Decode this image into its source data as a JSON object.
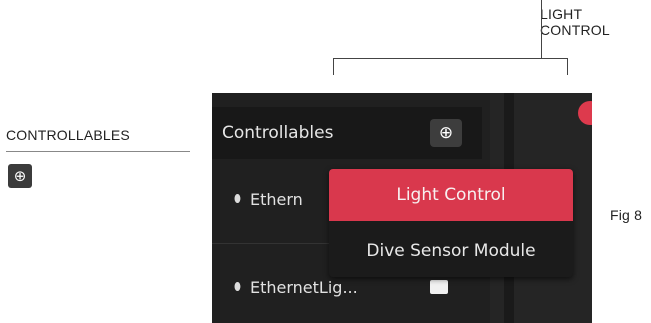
{
  "annotations": {
    "callout_line1": "LIGHT",
    "callout_line2": "CONTROL",
    "side_heading": "CONTROLLABLES",
    "side_plus_icon": "⊕",
    "figure_label": "Fig 8"
  },
  "panel": {
    "title": "Controllables",
    "add_icon": "⊕",
    "rows": [
      {
        "label": "Ethern"
      },
      {
        "label": "EthernetLig..."
      }
    ]
  },
  "menu": {
    "items": [
      {
        "label": "Light Control"
      },
      {
        "label": "Dive Sensor Module"
      }
    ]
  },
  "colors": {
    "accent": "#d9384d",
    "panel_bg": "#202020",
    "header_bg": "#181818"
  }
}
